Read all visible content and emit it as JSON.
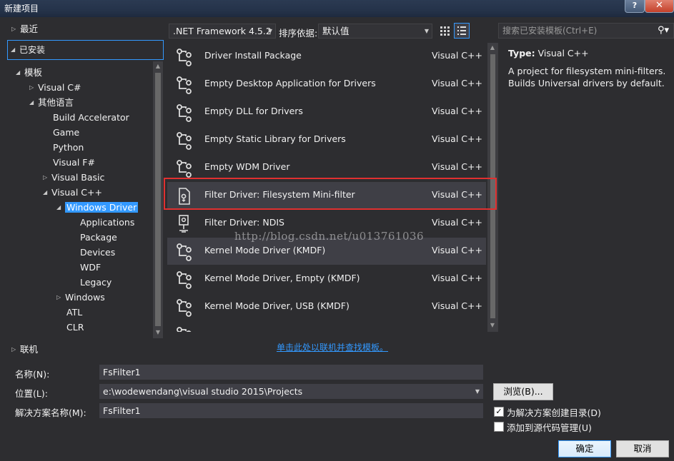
{
  "window": {
    "title": "新建项目",
    "help": "?",
    "close": "✕"
  },
  "tree": {
    "recent": "最近",
    "installed": "已安装",
    "templates": "模板",
    "visual_csharp": "Visual C#",
    "other_languages": "其他语言",
    "build_accelerator": "Build Accelerator",
    "game": "Game",
    "python": "Python",
    "visual_fsharp": "Visual F#",
    "visual_basic": "Visual Basic",
    "visual_cpp": "Visual C++",
    "windows_driver": "Windows Driver",
    "applications": "Applications",
    "package": "Package",
    "devices": "Devices",
    "wdf": "WDF",
    "legacy": "Legacy",
    "windows": "Windows",
    "atl": "ATL",
    "clr": "CLR",
    "online": "联机"
  },
  "toolbar": {
    "framework": ".NET Framework 4.5.2",
    "sort_label": "排序依据:",
    "sort_value": "默认值",
    "search_placeholder": "搜索已安装模板(Ctrl+E)"
  },
  "templates": [
    {
      "name": "Driver Install Package",
      "lang": "Visual C++"
    },
    {
      "name": "Empty Desktop Application for Drivers",
      "lang": "Visual C++"
    },
    {
      "name": "Empty DLL for Drivers",
      "lang": "Visual C++"
    },
    {
      "name": "Empty Static Library for Drivers",
      "lang": "Visual C++"
    },
    {
      "name": "Empty WDM Driver",
      "lang": "Visual C++"
    },
    {
      "name": "Filter Driver: Filesystem Mini-filter",
      "lang": "Visual C++"
    },
    {
      "name": "Filter Driver: NDIS",
      "lang": "Visual C++"
    },
    {
      "name": "Kernel Mode Driver (KMDF)",
      "lang": "Visual C++"
    },
    {
      "name": "Kernel Mode Driver, Empty (KMDF)",
      "lang": "Visual C++"
    },
    {
      "name": "Kernel Mode Driver, USB (KMDF)",
      "lang": "Visual C++"
    }
  ],
  "watermark": "http://blog.csdn.net/u013761036",
  "description": {
    "type_label": "Type:",
    "type_value": "Visual C++",
    "text": "A project for filesystem mini-filters. Builds Universal drivers by default."
  },
  "online_link": "单击此处以联机并查找模板。",
  "form": {
    "name_label": "名称(N):",
    "name_value": "FsFilter1",
    "location_label": "位置(L):",
    "location_value": "e:\\wodewendang\\visual studio 2015\\Projects",
    "solution_label": "解决方案名称(M):",
    "solution_value": "FsFilter1",
    "browse": "浏览(B)...",
    "create_dir_label": "为解决方案创建目录(D)",
    "create_dir_checked": "✓",
    "source_control_label": "添加到源代码管理(U)",
    "ok": "确定",
    "cancel": "取消"
  }
}
